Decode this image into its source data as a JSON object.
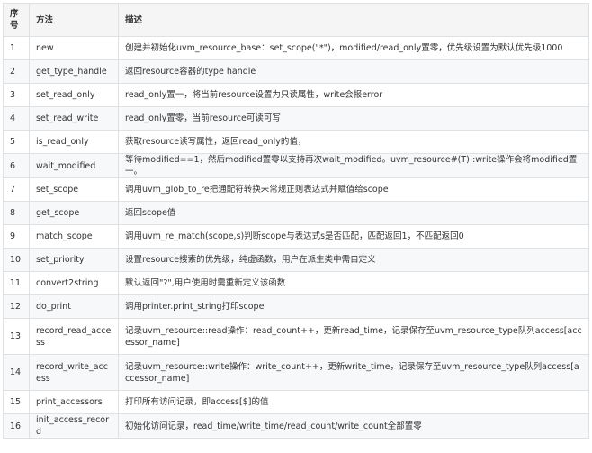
{
  "headers": [
    "序号",
    "方法",
    "描述"
  ],
  "rows": [
    {
      "no": "1",
      "method": "new",
      "desc": "创建并初始化uvm_resource_base：set_scope(\"*\")，modified/read_only置零，优先级设置为默认优先级1000"
    },
    {
      "no": "2",
      "method": "get_type_handle",
      "desc": "返回resource容器的type handle"
    },
    {
      "no": "3",
      "method": "set_read_only",
      "desc": "read_only置一，将当前resource设置为只读属性，write会报error"
    },
    {
      "no": "4",
      "method": "set_read_write",
      "desc": "read_only置零，当前resource可读可写"
    },
    {
      "no": "5",
      "method": "is_read_only",
      "desc": "获取resource读写属性，返回read_only的值，"
    },
    {
      "no": "6",
      "method": "wait_modified",
      "desc": "等待modified==1，然后modified置零以支持再次wait_modified。uvm_resource#(T)::write操作会将modified置一。"
    },
    {
      "no": "7",
      "method": "set_scope",
      "desc": "调用uvm_glob_to_re把通配符转换未常规正则表达式并赋值给scope"
    },
    {
      "no": "8",
      "method": "get_scope",
      "desc": "返回scope值"
    },
    {
      "no": "9",
      "method": "match_scope",
      "desc": "调用uvm_re_match(scope,s)判断scope与表达式s是否匹配，匹配返回1，不匹配返回0"
    },
    {
      "no": "10",
      "method": "set_priority",
      "desc": "设置resource搜索的优先级，纯虚函数，用户在派生类中需自定义"
    },
    {
      "no": "11",
      "method": "convert2string",
      "desc": "默认返回\"?\",用户使用时需重新定义该函数"
    },
    {
      "no": "12",
      "method": "do_print",
      "desc": "调用printer.print_string打印scope"
    },
    {
      "no": "13",
      "method": "record_read_access",
      "desc": "记录uvm_resource::read操作：read_count++，更新read_time，记录保存至uvm_resource_type队列access[accessor_name]"
    },
    {
      "no": "14",
      "method": "record_write_access",
      "desc": "记录uvm_resource::write操作：write_count++，更新write_time，记录保存至uvm_resource_type队列access[accessor_name]"
    },
    {
      "no": "15",
      "method": "print_accessors",
      "desc": "打印所有访问记录，即access[$]的值"
    },
    {
      "no": "16",
      "method": "init_access_record",
      "desc": "初始化访问记录，read_time/write_time/read_count/write_count全部置零"
    }
  ]
}
